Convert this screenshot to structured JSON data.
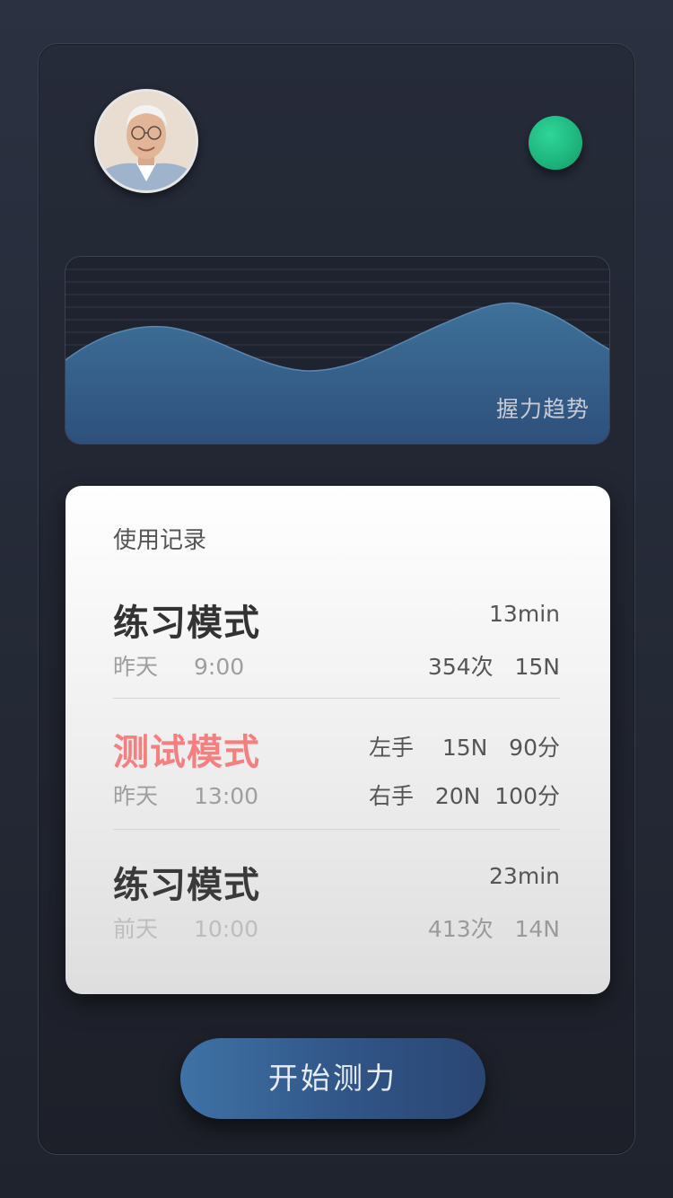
{
  "header": {
    "avatar_alt": "user avatar",
    "status_color": "#1eb47c"
  },
  "trend": {
    "label": "握力趋势",
    "fill_color": "#3a6a9a"
  },
  "records": {
    "title": "使用记录",
    "items": [
      {
        "mode": "练习模式",
        "day": "昨天",
        "time": "9:00",
        "right_top": "13min",
        "right_bottom": "354次   15N"
      },
      {
        "mode": "测试模式",
        "day": "昨天",
        "time": "13:00",
        "right_top": "左手    15N   90分",
        "right_bottom": "右手   20N  100分"
      },
      {
        "mode": "练习模式",
        "day": "前天",
        "time": "10:00",
        "right_top": "23min",
        "right_bottom": "413次   14N"
      }
    ]
  },
  "actions": {
    "start_label": "开始测力"
  }
}
